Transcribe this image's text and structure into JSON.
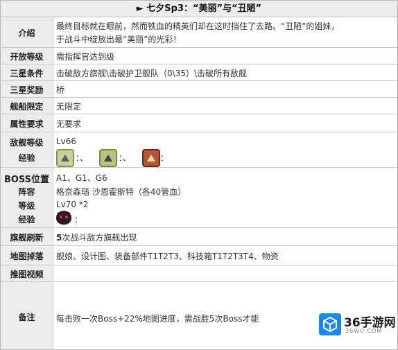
{
  "title": "► 七夕Sp3：“美丽”与“丑陋”",
  "rows": {
    "intro": {
      "label": "介绍",
      "line1": "最终目标就在眼前，然而铁血的精英们却在这时挡住了去路。“丑陋”的姐妹，",
      "line2": "于战斗中绽放出最“美丽”的光彩！"
    },
    "open": {
      "label": "开放等级",
      "value": "需指挥官达到级"
    },
    "three_star": {
      "label": "三星条件",
      "value": "击破敌方旗舰\\击破护卫舰队（0\\35）\\击破所有敌舰"
    },
    "reward": {
      "label": "三星奖励",
      "value": "桥"
    },
    "ship_limit": {
      "label": "舰船限定",
      "value": "无限定"
    },
    "attr": {
      "label": "属性要求",
      "value": "无要求"
    },
    "enemy": {
      "label1": "敌舰等级",
      "label2": "经验",
      "level": "Lv66",
      "exp_sep1": "：、",
      "exp_sep2": "：、",
      "exp_sep3": "："
    },
    "boss": {
      "label1": "BOSS位置",
      "label2": "阵容",
      "label3": "等级",
      "label4": "经验",
      "pos": "A1、G1、G6",
      "lineup": "格奈森瑙 沙恩霍斯特（各40管血）",
      "level": "Lv70 *2",
      "exp_sep": "："
    },
    "refresh": {
      "label": "旗舰刷新",
      "value_num": "5",
      "value_text": "次战斗敌方旗舰出现"
    },
    "drops": {
      "label": "地图掉落",
      "value": "舰娘、设计图、装备部件T1T2T3、科技箱T1T2T3T4、物资"
    },
    "video": {
      "label": "推图视频",
      "value": ""
    },
    "notes": {
      "label": "备注",
      "value": "每击败一次Boss+22%地图进度，需战胜5次Boss才能"
    }
  },
  "watermark": {
    "big": "36手游网",
    "small": "36WU.COM"
  },
  "colors": {
    "label_bg": "#ececec",
    "border": "#c8c8c8",
    "logo_blue": "#1e88e5"
  }
}
